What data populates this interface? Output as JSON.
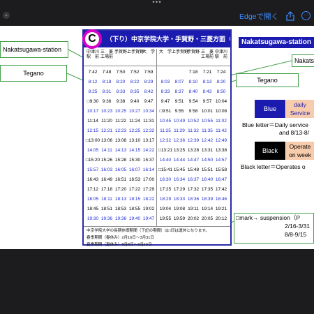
{
  "toolbar": {
    "edge_label": "Edgeで開く",
    "chevron_icon": "chevron-down-icon",
    "share_icon": "share-icon",
    "more_icon": "more-circle-icon",
    "accent": "#3d8bff"
  },
  "slide": {
    "left_labels": {
      "station": "Nakatsugawa-station",
      "tegano": "Tegano"
    },
    "right_labels": {
      "station": "Nakatsugawa-station",
      "naka_cut": "Nakatsu",
      "tegano": "Tegano"
    },
    "legend": {
      "blue_box": "Blue",
      "daily_line1": "daily",
      "daily_line2": "Service",
      "blue_note1": "Blue letter＝Daily service",
      "blue_note2": "and 8/13-8/",
      "black_box": "Black",
      "oper_line1": "Operate",
      "oper_line2": "on week",
      "black_note": "Black letter＝Operates o",
      "susp_line1": "□mark→  suspension（P",
      "susp_line2": "2/16-3/31",
      "susp_line3": "8/8-9/15"
    }
  },
  "timetable": {
    "badge": "C",
    "header": "（下り）中京学院大学・手賀野・三菱方面（上り）",
    "col_headers": {
      "left": [
        "中津川\n駅　前",
        "三　菱\n工場前",
        "手賀野",
        "上手賀野",
        "大　学"
      ],
      "right": [
        "大　学",
        "上手賀野",
        "手賀野",
        "三　菱\n工場前",
        "中津川\n駅　前"
      ]
    },
    "down_rows": [
      {
        "t": [
          "7:42",
          "7:48",
          "7:50",
          "7:52",
          "7:59"
        ],
        "c": "black"
      },
      {
        "t": [
          "8:12",
          "8:18",
          "8:20",
          "8:22",
          "8:29"
        ],
        "c": "blue"
      },
      {
        "t": [
          "8:25",
          "8:31",
          "8:33",
          "8:35",
          "8:42"
        ],
        "c": "blue"
      },
      {
        "t": [
          "□9:30",
          "9:36",
          "9:38",
          "9:40",
          "9:47"
        ],
        "c": "black"
      },
      {
        "t": [
          "10:17",
          "10:23",
          "10:25",
          "10:27",
          "10:34"
        ],
        "c": "blue"
      },
      {
        "t": [
          "11:14",
          "11:20",
          "11:22",
          "11:24",
          "11:31"
        ],
        "c": "black"
      },
      {
        "t": [
          "12:15",
          "12:21",
          "12:23",
          "12:25",
          "12:32"
        ],
        "c": "blue"
      },
      {
        "t": [
          "□13:00",
          "13:06",
          "13:08",
          "13:10",
          "13:17"
        ],
        "c": "black"
      },
      {
        "t": [
          "14:05",
          "14:11",
          "14:13",
          "14:15",
          "14:22"
        ],
        "c": "blue"
      },
      {
        "t": [
          "□15:20",
          "15:26",
          "15:28",
          "15:30",
          "15:37"
        ],
        "c": "black"
      },
      {
        "t": [
          "15:57",
          "16:03",
          "16:05",
          "16:07",
          "16:14"
        ],
        "c": "blue"
      },
      {
        "t": [
          "16:43",
          "16:49",
          "16:51",
          "16:53",
          "17:00"
        ],
        "c": "black"
      },
      {
        "t": [
          "17:12",
          "17:18",
          "17:20",
          "17:22",
          "17:29"
        ],
        "c": "black"
      },
      {
        "t": [
          "18:05",
          "18:11",
          "18:13",
          "18:15",
          "18:22"
        ],
        "c": "blue"
      },
      {
        "t": [
          "18:45",
          "18:51",
          "18:53",
          "18:55",
          "19:02"
        ],
        "c": "black"
      },
      {
        "t": [
          "19:30",
          "19:36",
          "19:38",
          "19:40",
          "19:47"
        ],
        "c": "blue"
      }
    ],
    "up_rows": [
      {
        "t": [
          "",
          "",
          "7:18",
          "7:21",
          "7:24"
        ],
        "c": "black"
      },
      {
        "t": [
          "8:03",
          "8:07",
          "8:10",
          "8:13",
          "8:20"
        ],
        "c": "blue"
      },
      {
        "t": [
          "8:33",
          "8:37",
          "8:40",
          "8:43",
          "8:50"
        ],
        "c": "blue"
      },
      {
        "t": [
          "9:47",
          "9:51",
          "9:54",
          "9:57",
          "10:04"
        ],
        "c": "black"
      },
      {
        "t": [
          "□9:51",
          "9:55",
          "9:58",
          "10:01",
          "10:08"
        ],
        "c": "black"
      },
      {
        "t": [
          "10:45",
          "10:49",
          "10:52",
          "10:55",
          "11:02"
        ],
        "c": "blue"
      },
      {
        "t": [
          "11:25",
          "11:29",
          "11:32",
          "11:35",
          "11:42"
        ],
        "c": "blue"
      },
      {
        "t": [
          "12:32",
          "12:36",
          "12:39",
          "12:42",
          "12:49"
        ],
        "c": "blue"
      },
      {
        "t": [
          "□13:21",
          "13:25",
          "13:28",
          "13:31",
          "13:38"
        ],
        "c": "black"
      },
      {
        "t": [
          "14:40",
          "14:44",
          "14:47",
          "14:50",
          "14:57"
        ],
        "c": "blue"
      },
      {
        "t": [
          "□15:41",
          "15:45",
          "15:48",
          "15:51",
          "15:58"
        ],
        "c": "black"
      },
      {
        "t": [
          "16:30",
          "16:34",
          "16:37",
          "16:40",
          "16:47"
        ],
        "c": "blue"
      },
      {
        "t": [
          "17:25",
          "17:29",
          "17:32",
          "17:35",
          "17:42"
        ],
        "c": "black"
      },
      {
        "t": [
          "18:29",
          "18:33",
          "18:36",
          "18:39",
          "18:46"
        ],
        "c": "blue"
      },
      {
        "t": [
          "19:04",
          "19:08",
          "19:11",
          "19:14",
          "19:21"
        ],
        "c": "black"
      },
      {
        "t": [
          "19:55",
          "19:59",
          "20:02",
          "20:05",
          "20:12"
        ],
        "c": "black"
      }
    ],
    "footer": {
      "line1": "中京学院大学の長期休暇期間（下記の期間）は□印は運休となります。",
      "line2": "春季期間（春休み）2月16日～3月31日",
      "line3": "夏季期間（夏休み）8月8日～9月15日"
    }
  }
}
